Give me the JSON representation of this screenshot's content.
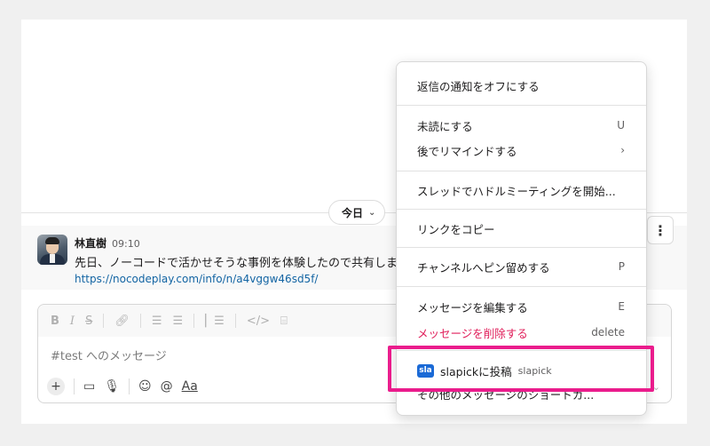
{
  "date_divider": {
    "label": "今日"
  },
  "message": {
    "author": "林直樹",
    "time": "09:10",
    "text": "先日、ノーコードで活かせそうな事例を体験したので共有しま",
    "link": "https://nocodeplay.com/info/n/a4vggw46sd5f/"
  },
  "composer": {
    "placeholder": "#test へのメッセージ",
    "format_icons": [
      "bold-icon",
      "italic-icon",
      "strikethrough-icon",
      "link-icon",
      "ordered-list-icon",
      "bulleted-list-icon",
      "blockquote-icon",
      "code-icon",
      "code-block-icon"
    ],
    "aa_label": "Aa"
  },
  "menu": {
    "turn_off_notifications": "返信の通知をオフにする",
    "mark_unread": {
      "label": "未読にする",
      "shortcut": "U"
    },
    "remind_later": {
      "label": "後でリマインドする",
      "shortcut": "›"
    },
    "huddle": "スレッドでハドルミーティングを開始...",
    "copy_link": "リンクをコピー",
    "pin": {
      "label": "チャンネルへピン留めする",
      "shortcut": "P"
    },
    "edit": {
      "label": "メッセージを編集する",
      "shortcut": "E"
    },
    "delete": {
      "label": "メッセージを削除する",
      "shortcut": "delete"
    },
    "slapick": {
      "icon_text": "sla",
      "label": "slapickに投稿",
      "sub": "slapick"
    },
    "more_shortcuts": "その他のメッセージのショートカ..."
  },
  "colors": {
    "danger": "#e01e5a",
    "highlight": "#ea1c8c",
    "link": "#1264a3",
    "app_icon": "#1b6ad6"
  }
}
